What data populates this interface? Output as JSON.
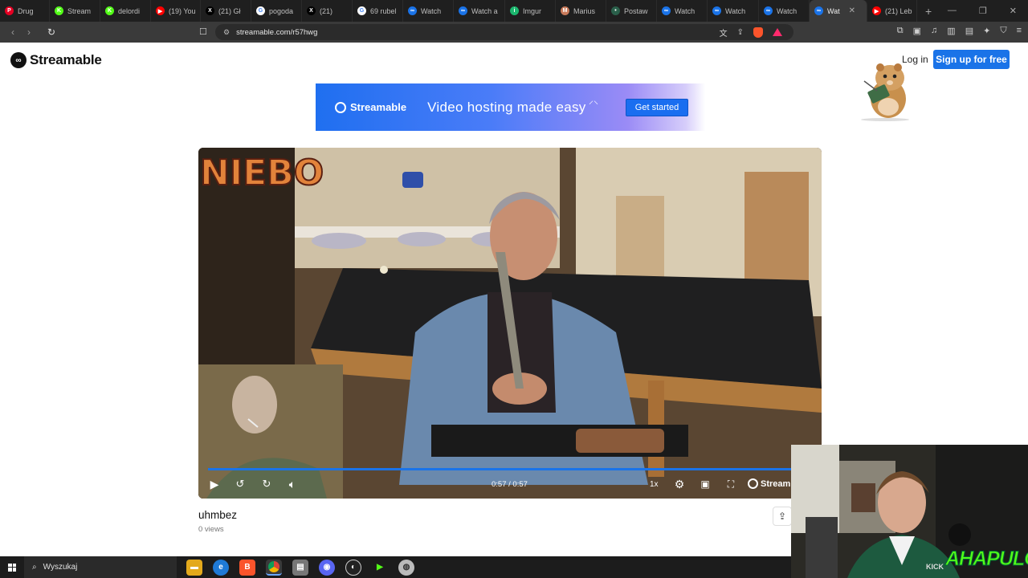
{
  "browser": {
    "tabs": [
      {
        "title": "Drug",
        "icon": "pinterest-icon",
        "color": "#e60023",
        "glyph": "P"
      },
      {
        "title": "Stream",
        "icon": "kick-icon",
        "color": "#53fc18",
        "glyph": "K"
      },
      {
        "title": "delordi",
        "icon": "kick-icon",
        "color": "#53fc18",
        "glyph": "K"
      },
      {
        "title": "(19) You",
        "icon": "youtube-icon",
        "color": "#ff0000",
        "glyph": "▶"
      },
      {
        "title": "(21) Gł",
        "icon": "x-icon",
        "color": "#000000",
        "glyph": "X"
      },
      {
        "title": "pogoda",
        "icon": "google-icon",
        "color": "#ffffff",
        "glyph": "G"
      },
      {
        "title": "(21)",
        "icon": "x-icon",
        "color": "#000000",
        "glyph": "X"
      },
      {
        "title": "69 rubel",
        "icon": "google-icon",
        "color": "#ffffff",
        "glyph": "G"
      },
      {
        "title": "Watch",
        "icon": "streamable-icon",
        "color": "#1a73e8",
        "glyph": "∞"
      },
      {
        "title": "Watch a",
        "icon": "streamable-icon",
        "color": "#1a73e8",
        "glyph": "∞"
      },
      {
        "title": "Imgur",
        "icon": "imgur-icon",
        "color": "#1bb76e",
        "glyph": "i"
      },
      {
        "title": "Marius",
        "icon": "profile-icon",
        "color": "#c97a5a",
        "glyph": "M"
      },
      {
        "title": "Postaw",
        "icon": "generic-icon",
        "color": "#2a5f4a",
        "glyph": "•"
      },
      {
        "title": "Watch",
        "icon": "streamable-icon",
        "color": "#1a73e8",
        "glyph": "∞"
      },
      {
        "title": "Watch",
        "icon": "streamable-icon",
        "color": "#1a73e8",
        "glyph": "∞"
      },
      {
        "title": "Watch",
        "icon": "streamable-icon",
        "color": "#1a73e8",
        "glyph": "∞"
      },
      {
        "title": "Wat",
        "icon": "streamable-icon",
        "color": "#1a73e8",
        "glyph": "∞",
        "active": true
      },
      {
        "title": "(21) Leb",
        "icon": "youtube-icon",
        "color": "#ff0000",
        "glyph": "▶"
      }
    ],
    "url": "streamable.com/r57hwg"
  },
  "site": {
    "brand": "Streamable",
    "login_label": "Log in",
    "signup_label": "Sign up for free"
  },
  "ad": {
    "brand": "Streamable",
    "tagline": "Video hosting made easy",
    "cta": "Get started"
  },
  "player": {
    "time": "0:57 / 0:57",
    "speed": "1x",
    "progress": 1.0,
    "watermark": "Stream",
    "overlay_text": "NIEBO"
  },
  "video": {
    "title": "uhmbez",
    "views": "0 views"
  },
  "webcam": {
    "kick_label": "KICK",
    "handle": "AHAPULCO"
  },
  "taskbar": {
    "search_label": "Wyszukaj"
  },
  "colors": {
    "accent": "#1a73e8",
    "kick_green": "#53fc18"
  }
}
